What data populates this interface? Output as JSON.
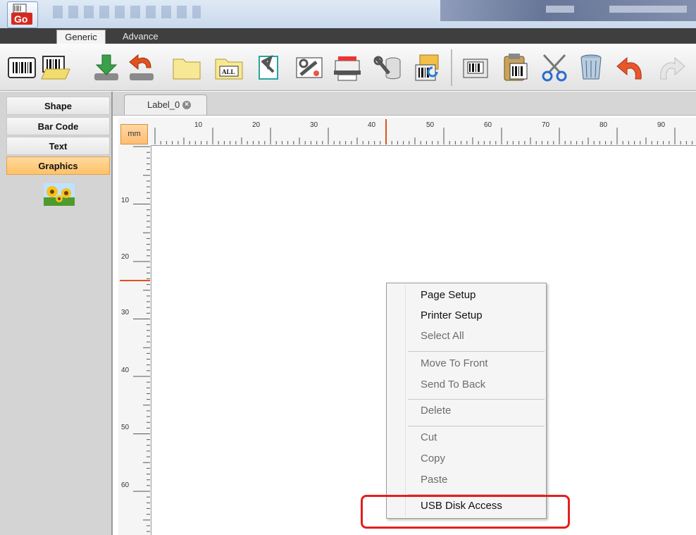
{
  "app": {
    "icon": "gologo-app-icon"
  },
  "ribbon_tabs": [
    {
      "label": "Generic",
      "active": true
    },
    {
      "label": "Advance",
      "active": false
    }
  ],
  "toolbar_icons": [
    "barcode-label-icon",
    "open-label-icon",
    "download-icon",
    "upload-icon",
    "folder-icon",
    "select-all-icon",
    "tools-icon",
    "settings-icon",
    "printer-icon",
    "database-tools-icon",
    "print-preview-icon",
    "label-printer-icon",
    "paste-icon",
    "cut-icon",
    "delete-icon",
    "undo-icon",
    "redo-icon"
  ],
  "left_panel": {
    "categories": [
      "Shape",
      "Bar Code",
      "Text",
      "Graphics"
    ],
    "active_category": "Graphics",
    "graphics_item_icon": "sunflower-image-icon"
  },
  "document_tab": {
    "label": "Label_0"
  },
  "ruler": {
    "unit": "mm",
    "h_marks": [
      "10",
      "20",
      "30",
      "40",
      "50",
      "60",
      "70",
      "80",
      "90"
    ],
    "v_marks": [
      "10",
      "20",
      "30",
      "40",
      "50",
      "60"
    ]
  },
  "context_menu": {
    "groups": [
      [
        {
          "label": "Page Setup",
          "enabled": true
        },
        {
          "label": "Printer Setup",
          "enabled": true
        },
        {
          "label": "Select All",
          "enabled": false
        }
      ],
      [
        {
          "label": "Move To Front",
          "enabled": false
        },
        {
          "label": "Send To Back",
          "enabled": false
        }
      ],
      [
        {
          "label": "Delete",
          "enabled": false
        }
      ],
      [
        {
          "label": "Cut",
          "enabled": false
        },
        {
          "label": "Copy",
          "enabled": false
        },
        {
          "label": "Paste",
          "enabled": false
        }
      ],
      [
        {
          "label": "USB Disk Access",
          "enabled": true
        }
      ]
    ]
  },
  "colors": {
    "highlight": "#e41f1f",
    "active_tab_orange": "#ffc266"
  }
}
